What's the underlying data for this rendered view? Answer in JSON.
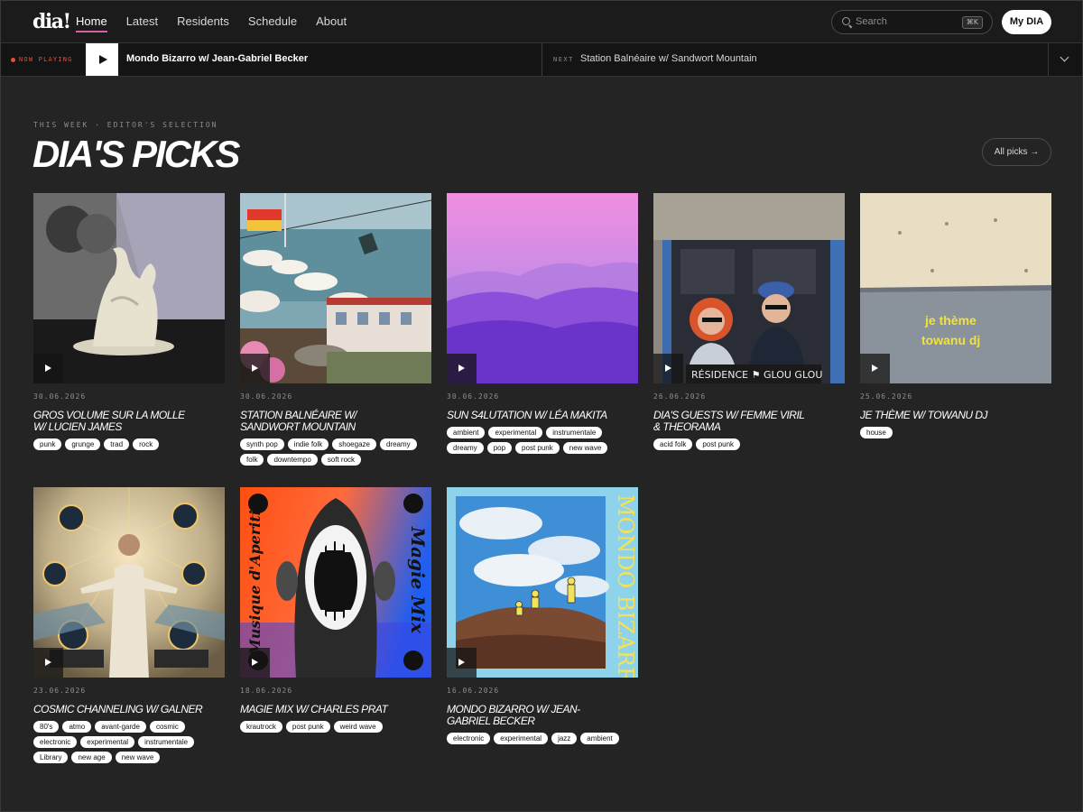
{
  "app": {
    "logo": "dia!",
    "nav": [
      {
        "label": "Home",
        "active": true
      },
      {
        "label": "Latest"
      },
      {
        "label": "Residents"
      },
      {
        "label": "Schedule"
      },
      {
        "label": "About"
      }
    ],
    "search_placeholder": "Search",
    "search_shortcut": "⌘K",
    "account_button": "My DIA",
    "accent_color": "#d65fa6"
  },
  "player": {
    "now_playing_label": "NOW PLAYING",
    "now_playing_title": "Mondo Bizarro w/ Jean-Gabriel Becker",
    "next_label": "NEXT",
    "next_title": "Station Balnéaire w/ Sandwort Mountain",
    "live_color": "#e0503b"
  },
  "section": {
    "kicker": "THIS WEEK · EDITOR'S SELECTION",
    "title": "DIA'S PICKS",
    "all_picks_button": "All picks →"
  },
  "cards": [
    {
      "date": "30.06.2026",
      "title": "Gros Volume sur la Molle w/ Lucien James",
      "tags": [
        "punk",
        "grunge",
        "trad",
        "rock"
      ]
    },
    {
      "date": "30.06.2026",
      "title": "Station Balnéaire w/ Sandwort Mountain",
      "tags": [
        "synth pop",
        "indie folk",
        "shoegaze",
        "dreamy",
        "folk",
        "downtempo",
        "soft rock"
      ]
    },
    {
      "date": "30.06.2026",
      "title": "Sun S4lutation w/ Léa Makita",
      "tags": [
        "ambient",
        "experimental",
        "instrumentale",
        "dreamy",
        "pop",
        "post punk",
        "new wave"
      ]
    },
    {
      "date": "26.06.2026",
      "title": "DIA's Guests w/ Femme Viril & Theorama",
      "tags": [
        "acid folk",
        "post punk"
      ]
    },
    {
      "date": "25.06.2026",
      "title": "Je Thème w/ Towanu DJ",
      "tags": [
        "house"
      ],
      "artwork_text": [
        "je thème",
        "towanu dj"
      ]
    },
    {
      "date": "23.06.2026",
      "title": "Cosmic Channeling w/ Galner",
      "tags": [
        "80's",
        "atmo",
        "avant-garde",
        "cosmic",
        "electronic",
        "experimental",
        "instrumentale",
        "Library",
        "new age",
        "new wave"
      ]
    },
    {
      "date": "18.06.2026",
      "title": "Magie Mix w/ Charles Prat",
      "tags": [
        "krautrock",
        "post punk",
        "weird wave"
      ],
      "artwork_text": [
        "Musique d'Aperitif",
        "Magie Mix"
      ]
    },
    {
      "date": "16.06.2026",
      "title": "Mondo Bizarro w/ Jean-Gabriel Becker",
      "tags": [
        "electronic",
        "experimental",
        "jazz",
        "ambient"
      ],
      "artwork_text": [
        "MONDO BIZARRO"
      ]
    }
  ]
}
